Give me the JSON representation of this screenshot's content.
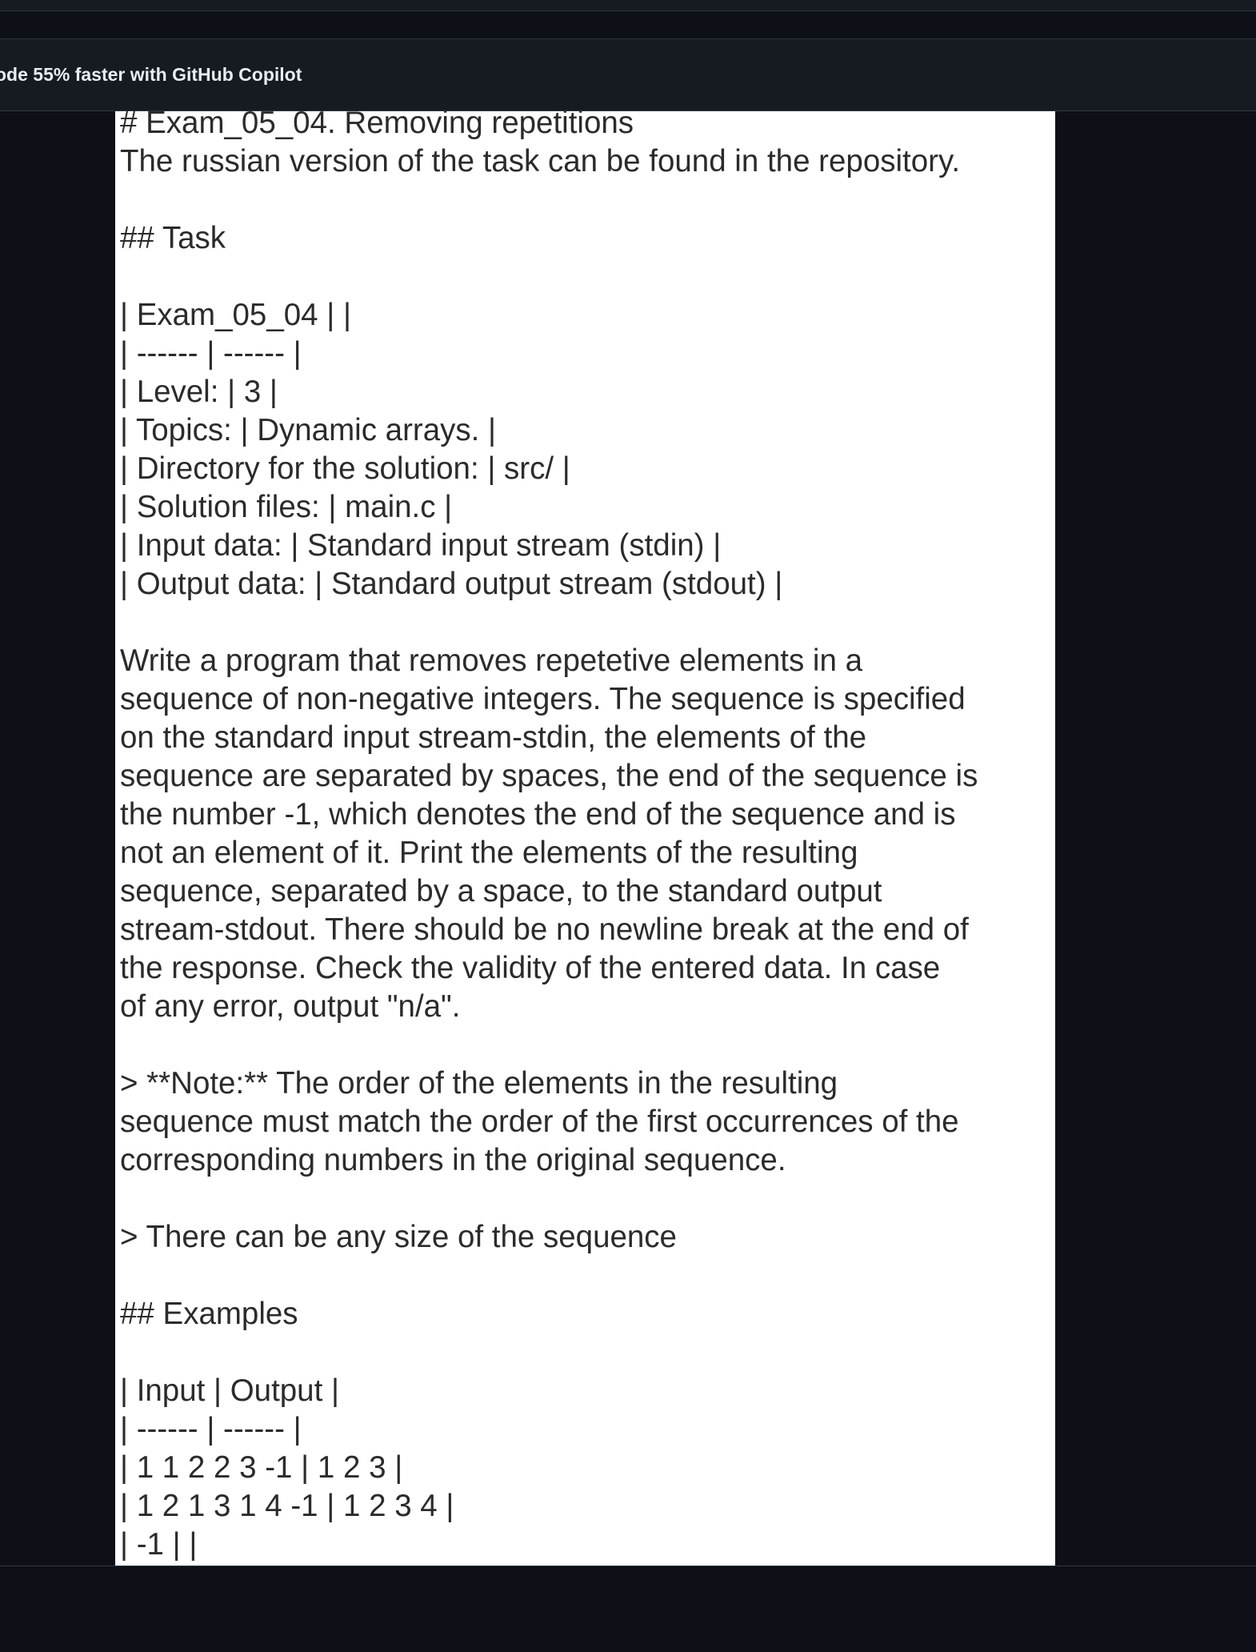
{
  "banner": {
    "text": "ode 55% faster with GitHub Copilot"
  },
  "document": {
    "lines": [
      "# Exam_05_04. Removing repetitions",
      "The russian version of the task can be found in the repository.",
      "",
      "## Task",
      "",
      "| Exam_05_04 | |",
      "| ------ | ------ |",
      "| Level: | 3 |",
      "| Topics: | Dynamic arrays. |",
      "| Directory for the solution: | src/ |",
      "| Solution files: | main.c |",
      "| Input data: | Standard input stream (stdin) |",
      "| Output data: | Standard output stream (stdout) |",
      "",
      "Write a program that removes repetetive elements in a",
      "sequence of non-negative integers. The sequence is specified",
      "on the standard input stream-stdin, the elements of the",
      "sequence are separated by spaces, the end of the sequence is",
      "the number -1, which denotes the end of the sequence and is",
      "not an element of it. Print the elements of the resulting",
      "sequence, separated by a space, to the standard output",
      "stream-stdout. There should be no newline break at the end of",
      "the response. Check the validity of the entered data. In case",
      "of any error, output \"n/a\".",
      "",
      "> **Note:** The order of the elements in the resulting",
      "sequence must match the order of the first occurrences of the",
      "corresponding numbers in the original sequence.",
      "",
      "> There can be any size of the sequence",
      "",
      "## Examples",
      "",
      "| Input | Output |",
      "| ------ | ------ |",
      "| 1 1 2 2 3 -1 | 1 2 3 |",
      "| 1 2 1 3 1 4 -1 | 1 2 3 4 |",
      "| -1 | |"
    ]
  }
}
